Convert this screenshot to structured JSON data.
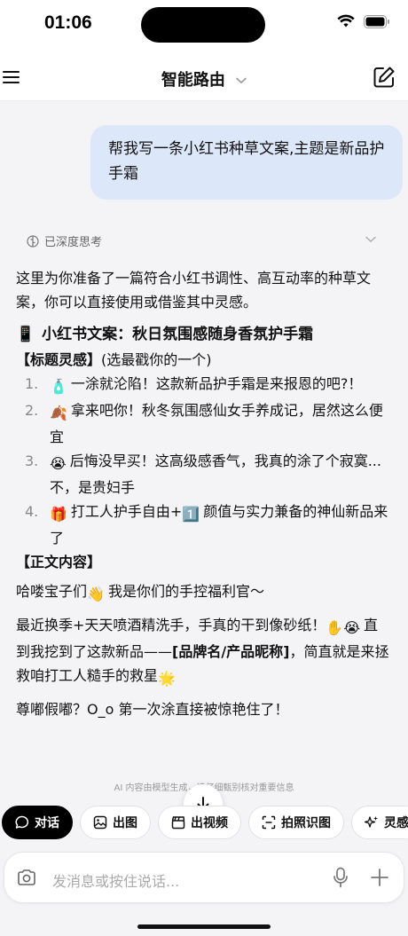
{
  "status": {
    "time": "01:06"
  },
  "header": {
    "title": "智能路由"
  },
  "chat": {
    "user_message": "帮我写一条小红书种草文案,主题是新品护手霜",
    "thinking_label": "已深度思考",
    "intro": "这里为你准备了一篇符合小红书调性、高互动率的种草文案，你可以直接使用或借鉴其中灵感。",
    "heading_emoji": "📱",
    "heading": "小红书文案：秋日氛围感随身香氛护手霜",
    "title_section": "【标题灵感】",
    "title_section_hint": "(选最戳你的一个)",
    "options": [
      {
        "num": "1.",
        "emoji": "🧴",
        "text": "一涂就沦陷！这款新品护手霜是来报恩的吧?！"
      },
      {
        "num": "2.",
        "emoji": "🍂",
        "text": "拿来吧你！秋冬氛围感仙女手养成记，居然这么便宜"
      },
      {
        "num": "3.",
        "emoji": "😭",
        "text": "后悔没早买！这高级感香气，我真的涂了个寂寞...不，是贵妇手"
      },
      {
        "num": "4.",
        "emoji": "🎁",
        "text_a": "打工人护手自由+",
        "emoji2": "1️⃣",
        "text_b": "颜值与实力兼备的神仙新品来了"
      }
    ],
    "body_section": "【正文内容】",
    "body_p1_a": "哈喽宝子们",
    "body_p1_emoji": "👋",
    "body_p1_b": "我是你们的手控福利官～",
    "body_p2_a": "最近换季+天天喷酒精洗手，手真的干到像砂纸！",
    "body_p2_emoji": "✋😭",
    "body_p2_b": "直到我挖到了这款新品——",
    "body_p2_bold": "[品牌名/产品昵称]",
    "body_p2_c": "，简直就是来拯救咱打工人糙手的救星",
    "body_p2_emoji2": "🌟",
    "body_p3": "尊嘟假嘟？O_o 第一次涂直接被惊艳住了！",
    "disclaimer": "AI 内容由模型生成，请仔细甄别核对重要信息"
  },
  "chips": [
    {
      "label": "对话",
      "icon": "chat-bubble-icon",
      "active": true
    },
    {
      "label": "出图",
      "icon": "image-icon",
      "active": false
    },
    {
      "label": "出视频",
      "icon": "clapperboard-icon",
      "active": false
    },
    {
      "label": "拍照识图",
      "icon": "scan-icon",
      "active": false
    },
    {
      "label": "灵感",
      "icon": "sparkle-icon",
      "active": false
    }
  ],
  "input": {
    "placeholder": "发消息或按住说话..."
  }
}
